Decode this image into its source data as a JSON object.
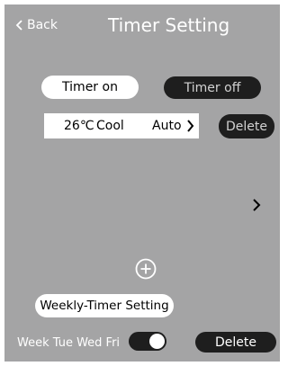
{
  "header": {
    "back_label": "Back",
    "title": "Timer Setting"
  },
  "tabs": {
    "timer_on": "Timer on",
    "timer_off": "Timer off"
  },
  "timer_entry": {
    "temperature": "26℃",
    "mode": "Cool",
    "fan": "Auto",
    "delete_label": "Delete"
  },
  "weekly": {
    "button_label": "Weekly-Timer Setting",
    "days": "Week Tue Wed Fri",
    "toggle_on": true,
    "delete_label": "Delete"
  },
  "icons": {
    "back": "chevron-left-icon",
    "entry_arrow": "chevron-right-icon",
    "next": "chevron-right-icon",
    "add": "plus-circle-icon"
  },
  "colors": {
    "background": "#a4a4a5",
    "dark_button": "#1e1e1e",
    "light_button": "#ffffff",
    "text_light": "#ffffff"
  }
}
